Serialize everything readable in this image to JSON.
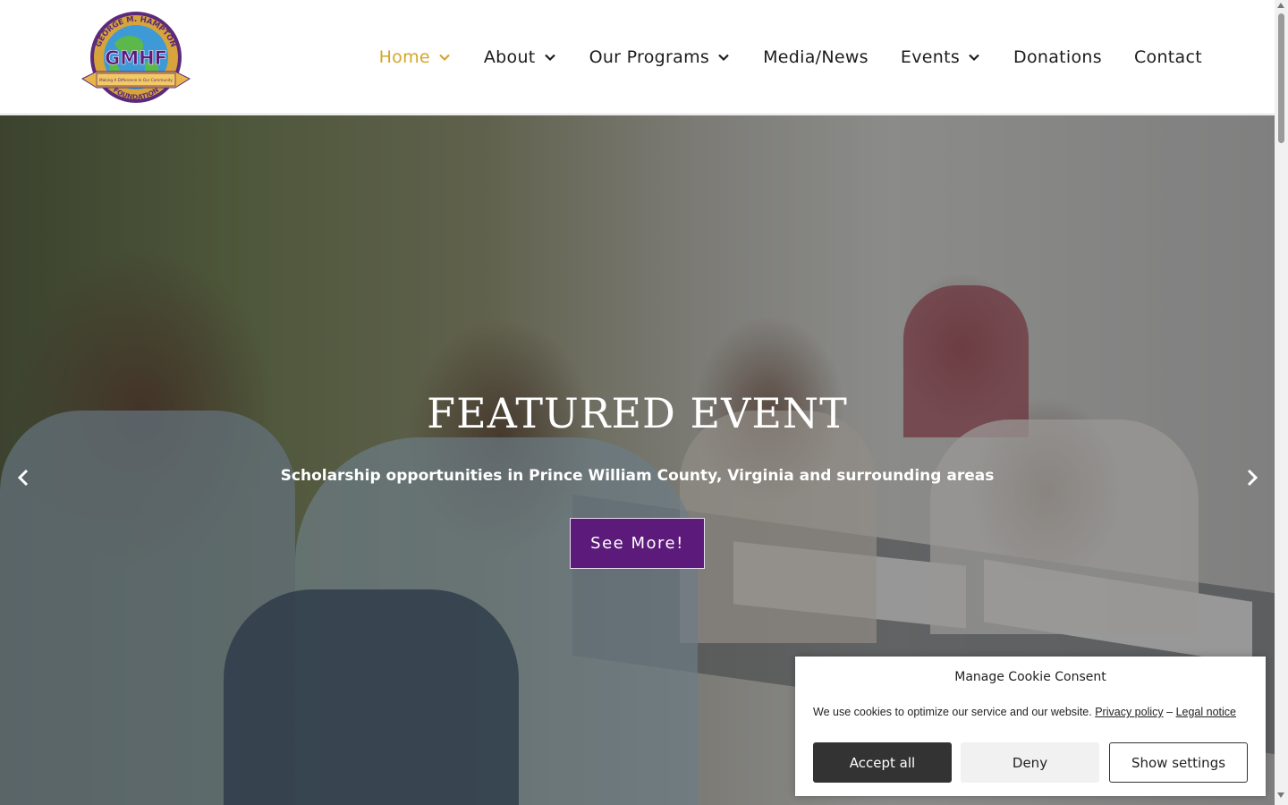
{
  "logo": {
    "arc_top": "GEORGE M. HAMPTON",
    "initials": "GMHF",
    "tagline": "Making A Difference In Our Community",
    "arc_bottom": "FOUNDATION"
  },
  "nav": {
    "items": [
      {
        "label": "Home",
        "has_dropdown": true,
        "active": true
      },
      {
        "label": "About",
        "has_dropdown": true,
        "active": false
      },
      {
        "label": "Our Programs",
        "has_dropdown": true,
        "active": false
      },
      {
        "label": "Media/News",
        "has_dropdown": false,
        "active": false
      },
      {
        "label": "Events",
        "has_dropdown": true,
        "active": false
      },
      {
        "label": "Donations",
        "has_dropdown": false,
        "active": false
      },
      {
        "label": "Contact",
        "has_dropdown": false,
        "active": false
      }
    ]
  },
  "hero": {
    "title": "FEATURED EVENT",
    "subtitle": "Scholarship opportunities in Prince William County, Virginia and surrounding areas",
    "button_label": "See More!",
    "prev_icon": "chevron-left-icon",
    "next_icon": "chevron-right-icon"
  },
  "cookie": {
    "title": "Manage Cookie Consent",
    "text": "We use cookies to optimize our service and our website.",
    "privacy_link": "Privacy policy",
    "separator": "–",
    "legal_link": "Legal notice",
    "accept_label": "Accept all",
    "deny_label": "Deny",
    "settings_label": "Show settings"
  },
  "colors": {
    "nav_active": "#d4a628",
    "button_purple": "#5c1a7a",
    "accept_bg": "#333333",
    "deny_bg": "#f1f1f1"
  }
}
